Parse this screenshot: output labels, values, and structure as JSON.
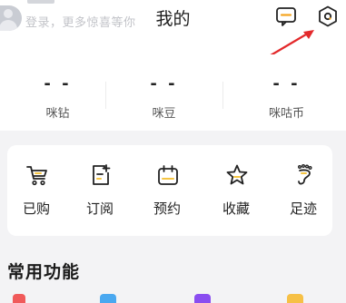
{
  "header": {
    "title": "我的",
    "login_hint": "登录，更多惊喜等你",
    "message_icon": "message-icon",
    "settings_icon": "settings-icon"
  },
  "stats": [
    {
      "value": "- -",
      "label": "咪钻"
    },
    {
      "value": "- -",
      "label": "咪豆"
    },
    {
      "value": "- -",
      "label": "咪咕币"
    }
  ],
  "shortcuts": [
    {
      "label": "已购",
      "icon": "cart-icon"
    },
    {
      "label": "订阅",
      "icon": "subscribe-icon"
    },
    {
      "label": "预约",
      "icon": "calendar-icon"
    },
    {
      "label": "收藏",
      "icon": "star-icon"
    },
    {
      "label": "足迹",
      "icon": "footprint-icon"
    }
  ],
  "section": {
    "title": "常用功能"
  },
  "colors": {
    "accent": "#e8332a",
    "arrow": "#e3292b",
    "icon_yellow": "#f5c542",
    "peek_red": "#f05a5a",
    "peek_blue": "#4aa8f0",
    "peek_purple": "#8a4df0",
    "peek_yellow": "#f6c046"
  }
}
